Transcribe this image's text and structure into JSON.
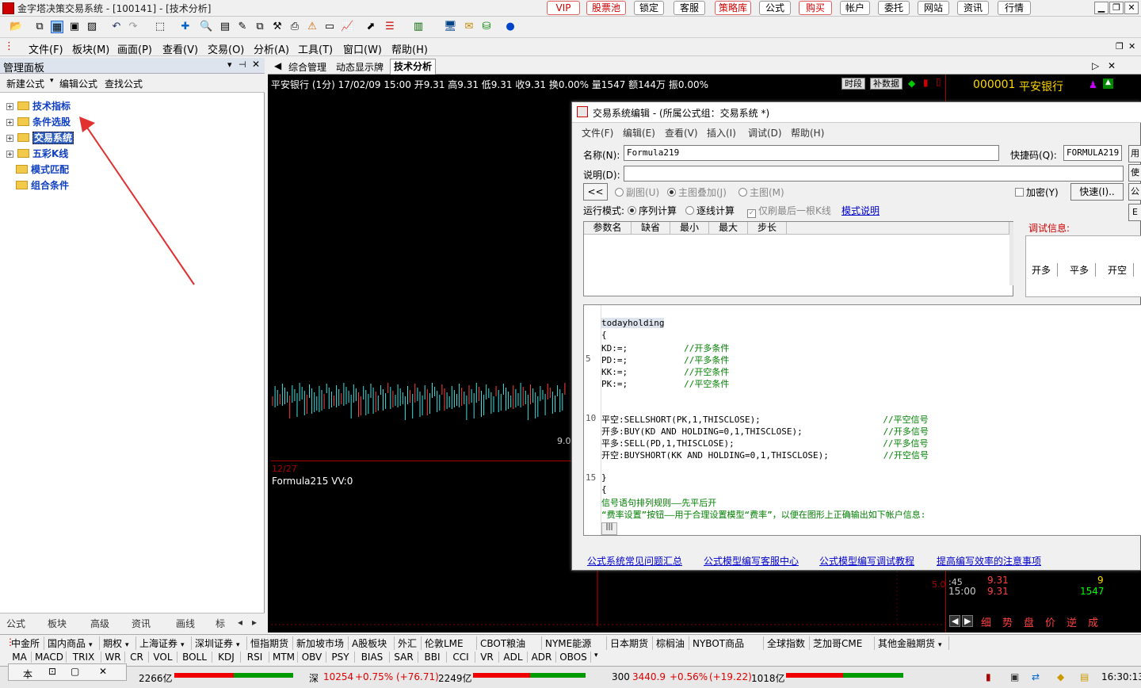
{
  "window": {
    "title": "金字塔决策交易系统 - [100141] - [技术分析]"
  },
  "top_buttons": [
    {
      "label": "VIP",
      "style": "red"
    },
    {
      "label": "股票池",
      "style": "red"
    },
    {
      "label": "锁定",
      "style": "blk"
    },
    {
      "label": "客服",
      "style": "blk"
    },
    {
      "label": "策略库",
      "style": "red"
    },
    {
      "label": "公式",
      "style": "blk"
    },
    {
      "label": "购买",
      "style": "red"
    },
    {
      "label": "帐户",
      "style": "blk"
    },
    {
      "label": "委托",
      "style": "blk"
    },
    {
      "label": "网站",
      "style": "blk"
    },
    {
      "label": "资讯",
      "style": "blk"
    },
    {
      "label": "行情",
      "style": "blk"
    }
  ],
  "menu": [
    "文件(F)",
    "板块(M)",
    "画面(P)",
    "查看(V)",
    "交易(O)",
    "分析(A)",
    "工具(T)",
    "窗口(W)",
    "帮助(H)"
  ],
  "left_panel": {
    "title": "管理面板",
    "tools": [
      "新建公式",
      "编辑公式",
      "查找公式"
    ],
    "tree": [
      {
        "label": "技术指标",
        "expander": "+"
      },
      {
        "label": "条件选股",
        "expander": "+"
      },
      {
        "label": "交易系统",
        "expander": "+",
        "selected": true
      },
      {
        "label": "五彩K线",
        "expander": "+"
      },
      {
        "label": "模式匹配",
        "expander": ""
      },
      {
        "label": "组合条件",
        "expander": ""
      }
    ],
    "tabs": [
      "公式",
      "板块",
      "高级",
      "资讯",
      "画线",
      "标"
    ]
  },
  "chart": {
    "tabs": [
      "综合管理",
      "动态显示牌",
      "技术分析"
    ],
    "info": "平安银行 (1分) 17/02/09 15:00 开9.31 高9.31 低9.31 收9.31 换0.00% 量1547 额144万 振0.00%",
    "btn_period": "时段",
    "btn_data": "补数据",
    "code": "000001",
    "name": "平安银行",
    "date_label": "12/27",
    "formula_label": "Formula215 VV:0",
    "price_label": "9.0",
    "right_rows": [
      {
        "time": "15:00",
        "price": "9.31",
        "vol": "1547"
      },
      {
        "time": ":45",
        "price": "9.31",
        "vol": "9"
      }
    ],
    "right_scale": "5.0",
    "right_tabs": [
      "细",
      "势",
      "盘",
      "价",
      "逆",
      "成"
    ]
  },
  "dialog": {
    "title": "交易系统编辑 - (所属公式组：交易系统 *)",
    "menu": [
      "文件(F)",
      "编辑(E)",
      "查看(V)",
      "插入(I)",
      "调试(D)",
      "帮助(H)"
    ],
    "name_label": "名称(N):",
    "name_value": "Formula219",
    "shortcut_label": "快捷码(Q):",
    "shortcut_value": "FORMULA219",
    "desc_label": "说明(D):",
    "collapse_btn": "<<",
    "radio_sub": "副图(U)",
    "radio_overlay": "主图叠加(J)",
    "radio_main": "主图(M)",
    "encrypt": "加密(Y)",
    "quick_btn": "快速(I)..",
    "run_mode_label": "运行模式:",
    "run_seq": "序列计算",
    "run_step": "逐线计算",
    "last_only": "仅刷最后一根K线",
    "mode_link": "模式说明",
    "grid_headers": [
      "参数名",
      "缺省",
      "最小",
      "最大",
      "步长"
    ],
    "debug_label": "调试信息:",
    "debug_tabs": [
      "开多",
      "平多",
      "开空"
    ],
    "side_btns": [
      "用",
      "使",
      "公",
      "E"
    ],
    "code_lines": [
      {
        "ln": "",
        "text": "todayholding",
        "cmt": ""
      },
      {
        "ln": "",
        "text": "{",
        "cmt": ""
      },
      {
        "ln": "",
        "text": "KD:=;",
        "cmt": "//开多条件"
      },
      {
        "ln": "5",
        "text": "PD:=;",
        "cmt": "//平多条件"
      },
      {
        "ln": "",
        "text": "KK:=;",
        "cmt": "//开空条件"
      },
      {
        "ln": "",
        "text": "PK:=;",
        "cmt": "//平空条件"
      },
      {
        "ln": "",
        "text": "",
        "cmt": ""
      },
      {
        "ln": "",
        "text": "",
        "cmt": ""
      },
      {
        "ln": "10",
        "text": "平空:SELLSHORT(PK,1,THISCLOSE);",
        "cmt": "//平空信号"
      },
      {
        "ln": "",
        "text": "开多:BUY(KD AND HOLDING=0,1,THISCLOSE);",
        "cmt": "//开多信号"
      },
      {
        "ln": "",
        "text": "平多:SELL(PD,1,THISCLOSE);",
        "cmt": "//平多信号"
      },
      {
        "ln": "",
        "text": "开空:BUYSHORT(KK AND HOLDING=0,1,THISCLOSE);",
        "cmt": "//开空信号"
      },
      {
        "ln": "",
        "text": "",
        "cmt": ""
      },
      {
        "ln": "15",
        "text": "}",
        "cmt": ""
      },
      {
        "ln": "",
        "text": "{",
        "cmt": ""
      },
      {
        "ln": "",
        "text": "信号语句排列规则——先平后开",
        "cmt": ""
      },
      {
        "ln": "",
        "text": "“费率设置”按钮——用于合理设置模型“费率”，以便在图形上正确输出如下帐户信息:",
        "cmt": ""
      }
    ],
    "links": [
      "公式系统常见问题汇总",
      "公式模型编写客服中心",
      "公式模型编写调试教程",
      "提高编写效率的注意事项"
    ]
  },
  "bottom_tabs1": [
    "中金所",
    "国内商品",
    "期权",
    "上海证券",
    "深圳证券",
    "恒指期货",
    "新加坡市场",
    "A股板块",
    "外汇",
    "伦敦LME",
    "CBOT粮油",
    "NYME能源",
    "日本期货",
    "棕榈油",
    "NYBOT商品",
    "全球指数",
    "芝加哥CME",
    "其他金融期货"
  ],
  "bottom_tabs2": [
    "MA",
    "MACD",
    "TRIX",
    "WR",
    "CR",
    "VOL",
    "BOLL",
    "KDJ",
    "RSI",
    "MTM",
    "OBV",
    "PSY",
    "BIAS",
    "SAR",
    "BBI",
    "CCI",
    "VR",
    "ADL",
    "ADR",
    "OBOS"
  ],
  "status": {
    "left": "本",
    "amt1": "2266亿",
    "sz_label": "深",
    "sz_value": "10254",
    "sz_pct": "+0.75%",
    "sz_chg": "(+76.71)",
    "amt2": "2249亿",
    "hs_label": "300",
    "hs_value": "3440.9",
    "hs_pct": "+0.56%",
    "hs_chg": "(+19.22)",
    "amt3": "1018亿",
    "time": "16:30:13"
  },
  "colors": {
    "accent_red": "#d00000",
    "up": "#ff4040",
    "down": "#00c0c0",
    "link": "#0000cc"
  }
}
